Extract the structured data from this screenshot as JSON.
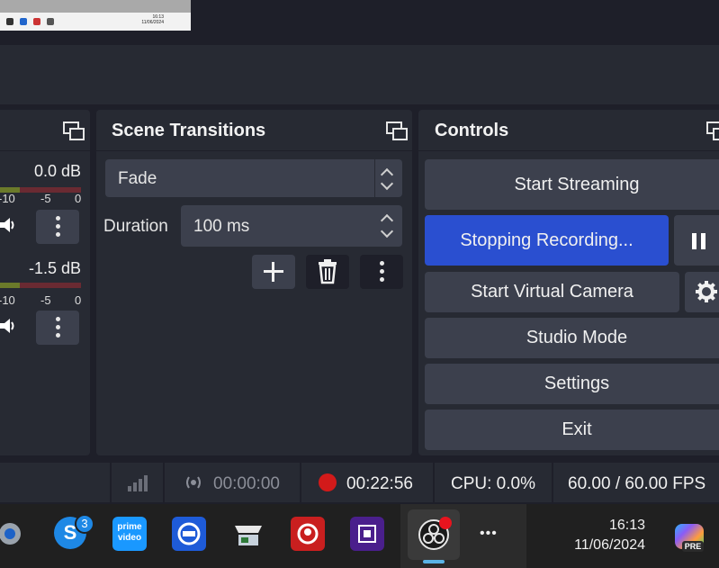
{
  "panels": {
    "audio": {
      "tracks": [
        {
          "db": "0.0 dB",
          "ticks": [
            "-10",
            "-5",
            "0"
          ]
        },
        {
          "db": "-1.5 dB",
          "ticks": [
            "-10",
            "-5",
            "0"
          ]
        }
      ]
    },
    "transitions": {
      "title": "Scene Transitions",
      "type_value": "Fade",
      "duration_label": "Duration",
      "duration_value": "100 ms"
    },
    "controls": {
      "title": "Controls",
      "start_streaming": "Start Streaming",
      "stopping_recording": "Stopping Recording...",
      "start_virtual_camera": "Start Virtual Camera",
      "studio_mode": "Studio Mode",
      "settings": "Settings",
      "exit": "Exit"
    }
  },
  "status_bar": {
    "stream_time": "00:00:00",
    "record_time": "00:22:56",
    "cpu": "CPU: 0.0%",
    "fps": "60.00 / 60.00 FPS"
  },
  "taskbar": {
    "skype_badge": "3",
    "prime_label_1": "prime",
    "prime_label_2": "video",
    "copilot_badge": "PRE",
    "more": "•••",
    "time": "16:13",
    "date": "11/06/2024"
  },
  "thumbnail": {
    "time": "16:13",
    "date": "11/06/2024"
  },
  "colors": {
    "accent": "#2a4fd0",
    "record": "#d21a1a",
    "panel": "#272a33",
    "button": "#3c404d"
  }
}
